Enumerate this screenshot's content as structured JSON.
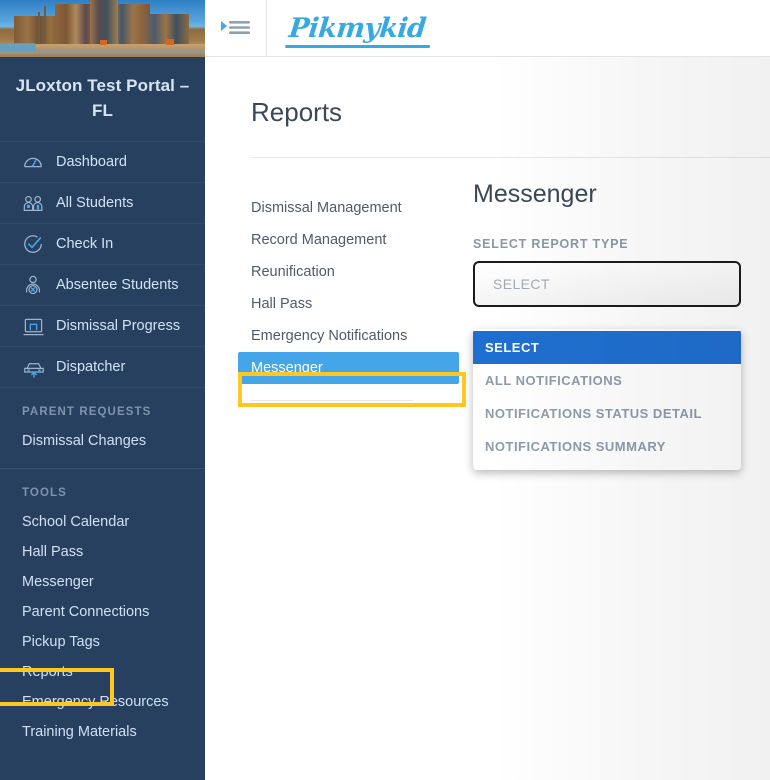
{
  "sidebar": {
    "school_photo_alt": "school-building-photo",
    "school_name": "JLoxton Test Portal – FL",
    "nav_items": [
      {
        "label": "Dashboard",
        "icon": "dashboard-gauge-icon"
      },
      {
        "label": "All Students",
        "icon": "students-group-icon"
      },
      {
        "label": "Check In",
        "icon": "check-circle-icon"
      },
      {
        "label": "Absentee Students",
        "icon": "absent-person-icon"
      },
      {
        "label": "Dismissal Progress",
        "icon": "monitor-icon"
      },
      {
        "label": "Dispatcher",
        "icon": "car-icon"
      }
    ],
    "parent_requests": {
      "section_label": "PARENT REQUESTS",
      "items": [
        {
          "label": "Dismissal Changes"
        }
      ]
    },
    "tools": {
      "section_label": "TOOLS",
      "items": [
        {
          "label": "School Calendar"
        },
        {
          "label": "Hall Pass"
        },
        {
          "label": "Messenger"
        },
        {
          "label": "Parent Connections"
        },
        {
          "label": "Pickup Tags"
        },
        {
          "label": "Reports",
          "highlighted": true
        },
        {
          "label": "Emergency Resources"
        },
        {
          "label": "Training Materials"
        }
      ]
    }
  },
  "topbar": {
    "menu_toggle_icon": "hamburger-menu-icon",
    "logo_text": "Pikmykid"
  },
  "page": {
    "title": "Reports"
  },
  "report_categories": {
    "items": [
      {
        "label": "Dismissal Management",
        "selected": false
      },
      {
        "label": "Record Management",
        "selected": false
      },
      {
        "label": "Reunification",
        "selected": false
      },
      {
        "label": "Hall Pass",
        "selected": false
      },
      {
        "label": "Emergency Notifications",
        "selected": false
      },
      {
        "label": "Messenger",
        "selected": true
      }
    ]
  },
  "report_panel": {
    "title": "Messenger",
    "field_label": "SELECT REPORT TYPE",
    "select_value": "SELECT",
    "select_placeholder": "SELECT",
    "dropdown_options": [
      {
        "label": "SELECT",
        "active": true
      },
      {
        "label": "ALL NOTIFICATIONS",
        "active": false
      },
      {
        "label": "NOTIFICATIONS STATUS DETAIL",
        "active": false
      },
      {
        "label": "NOTIFICATIONS SUMMARY",
        "active": false
      }
    ]
  },
  "colors": {
    "sidebar_bg": "#27405f",
    "highlight_gold": "#ffc71f",
    "selected_blue": "#44a5e8",
    "dropdown_active_blue": "#1f6fd0",
    "logo_blue": "#36a9e1"
  }
}
